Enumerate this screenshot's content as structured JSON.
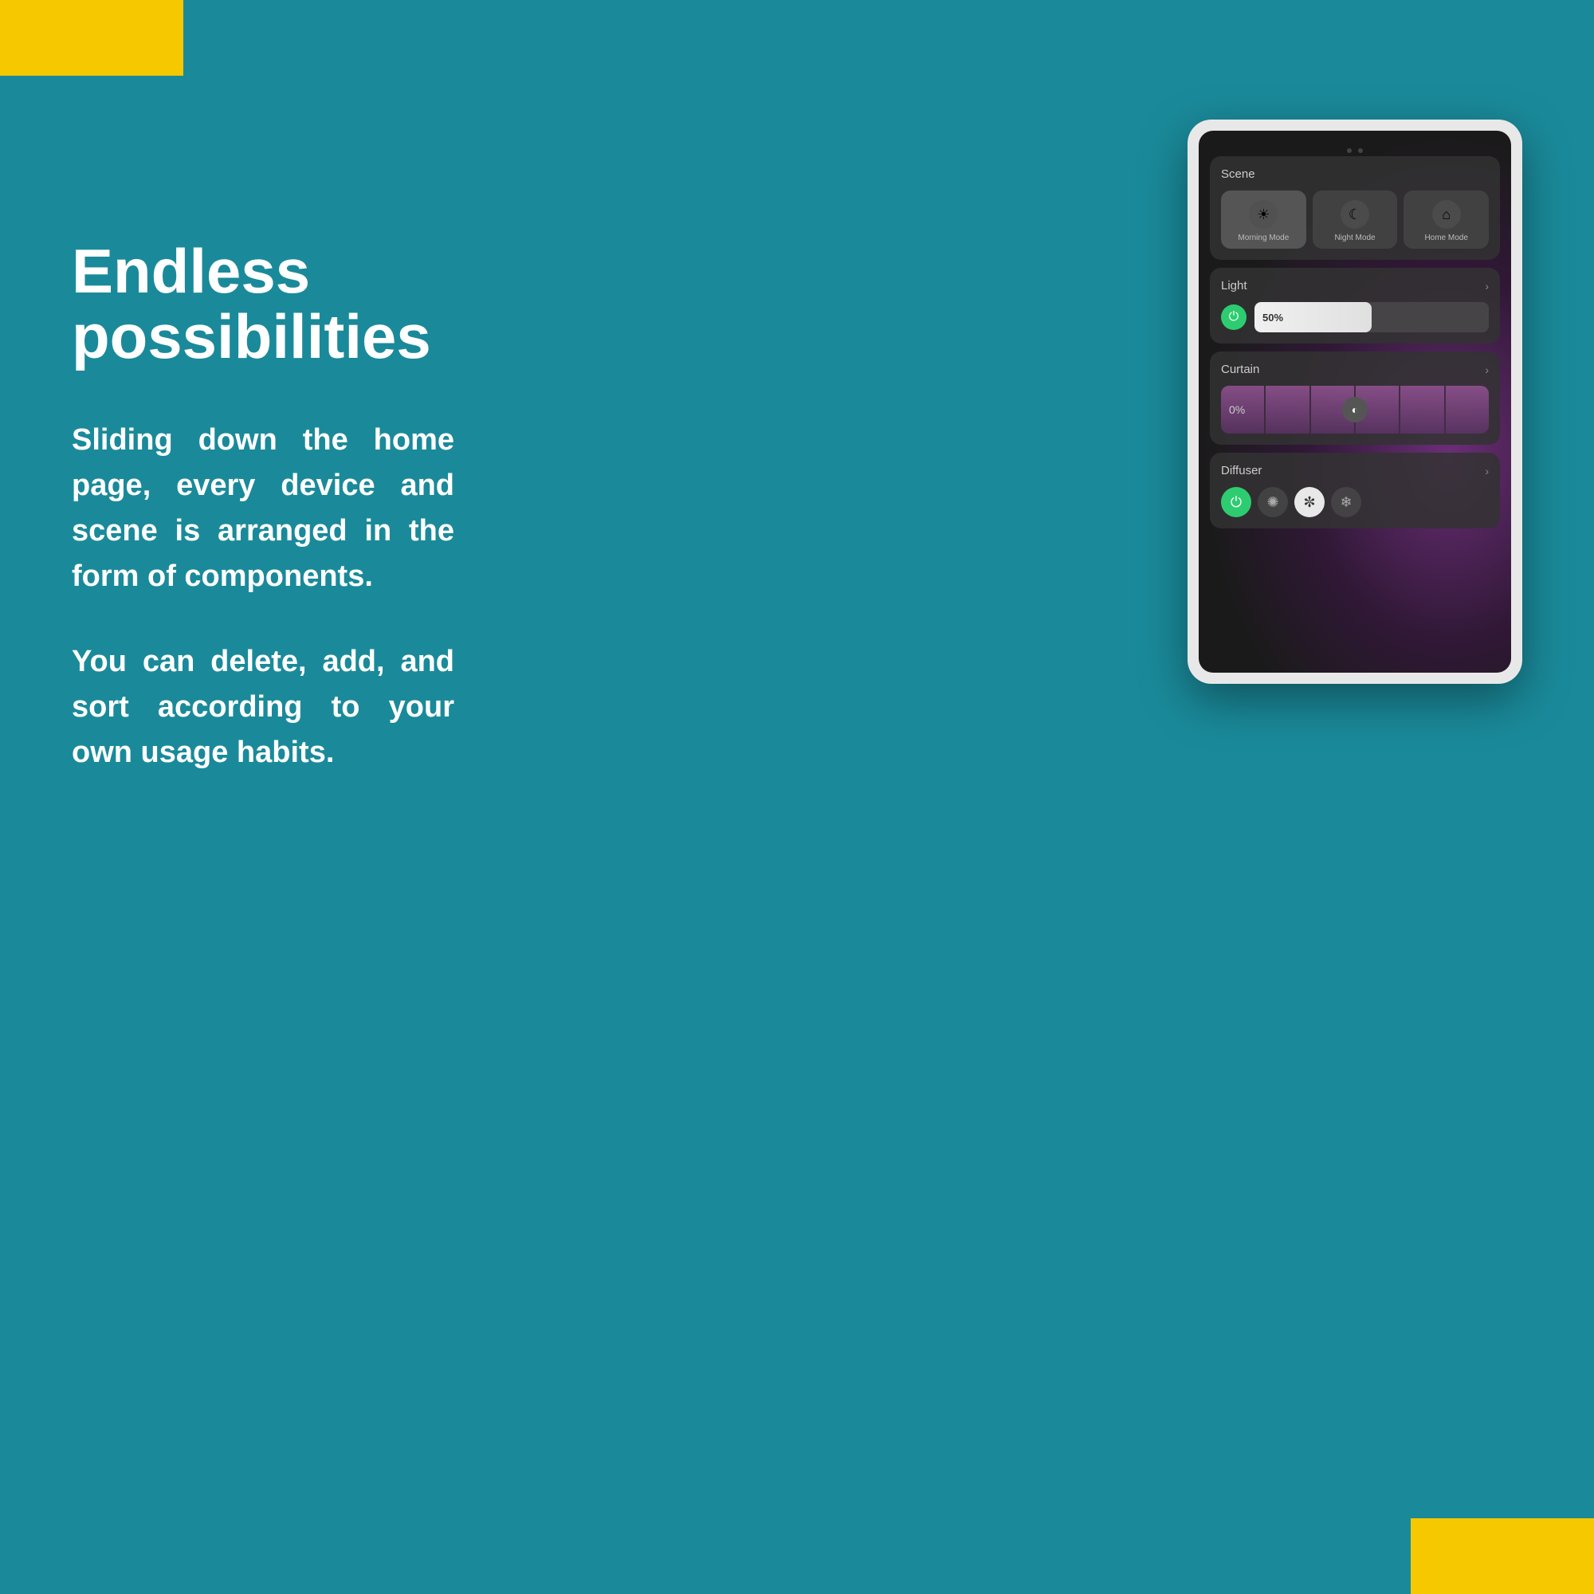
{
  "background_color": "#1a8a9a",
  "accent_color": "#f5c800",
  "corner_tl": {
    "visible": true
  },
  "corner_br": {
    "visible": true
  },
  "left": {
    "headline": "Endless possibilities",
    "para1": "Sliding down the home page, every device and scene is arranged in the form of components.",
    "para2": "You can delete, add, and sort according to your own usage habits."
  },
  "device": {
    "camera_dots": 2,
    "scene_section": {
      "label": "Scene",
      "buttons": [
        {
          "icon": "☀",
          "label": "Morning Mode",
          "active": true
        },
        {
          "icon": "☾",
          "label": "Night Mode",
          "active": false
        },
        {
          "icon": "⌂",
          "label": "Home Mode",
          "active": false
        }
      ]
    },
    "light_section": {
      "label": "Light",
      "has_arrow": true,
      "power_on": true,
      "percentage": "50%"
    },
    "curtain_section": {
      "label": "Curtain",
      "has_arrow": true,
      "percentage": "0%"
    },
    "diffuser_section": {
      "label": "Diffuser",
      "has_arrow": true,
      "power_on": true,
      "speeds": [
        "slow",
        "medium-active",
        "fast"
      ]
    }
  }
}
